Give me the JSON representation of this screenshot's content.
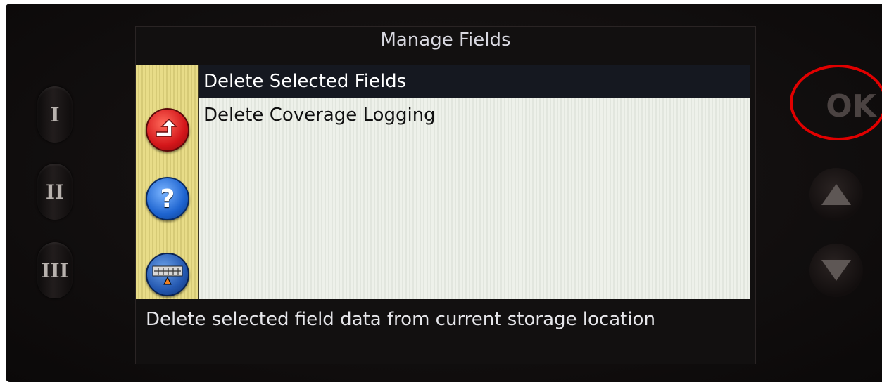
{
  "screen": {
    "title": "Manage Fields",
    "menu_items": [
      {
        "label": "Delete Selected Fields",
        "selected": true
      },
      {
        "label": "Delete Coverage Logging",
        "selected": false
      }
    ],
    "description": "Delete selected field data from current storage location"
  },
  "sidebar": {
    "icons": [
      "back-arrow-icon",
      "help-icon",
      "field-map-icon"
    ]
  },
  "hardware": {
    "soft_keys": [
      "I",
      "II",
      "III"
    ],
    "ok_label": "OK",
    "nav": [
      "up-arrow-icon",
      "down-arrow-icon"
    ]
  },
  "colors": {
    "highlight_circle": "#e00000",
    "selection_bg": "#151820",
    "sidebar": "#e8dc88"
  }
}
